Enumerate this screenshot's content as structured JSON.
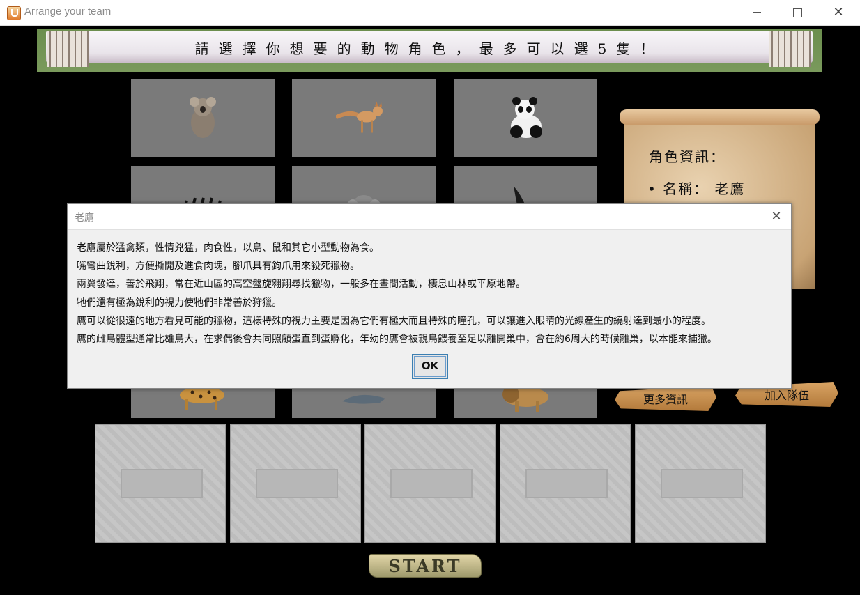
{
  "window": {
    "title": "Arrange your team",
    "minimize_icon": "minimize-icon",
    "maximize_icon": "maximize-icon",
    "close_icon": "close-icon"
  },
  "banner": {
    "text": "請選擇你想要的動物角色，最多可以選5隻！"
  },
  "animals": [
    {
      "name": "koala",
      "icon": "koala-image"
    },
    {
      "name": "fox",
      "icon": "fox-image"
    },
    {
      "name": "panda",
      "icon": "panda-image"
    },
    {
      "name": "zebra",
      "icon": "zebra-image"
    },
    {
      "name": "elephant",
      "icon": "elephant-image"
    },
    {
      "name": "eagle",
      "icon": "eagle-image"
    },
    {
      "name": "leopard",
      "icon": "leopard-image"
    },
    {
      "name": "shark",
      "icon": "shark-image"
    },
    {
      "name": "lion",
      "icon": "lion-image"
    }
  ],
  "info_scroll": {
    "title": "角色資訊：",
    "name_line": "• 名稱： 老鷹"
  },
  "buttons": {
    "more_info": "更多資訊",
    "join_team": "加入隊伍",
    "start": "START"
  },
  "team_slots": [
    "empty",
    "empty",
    "empty",
    "empty",
    "empty"
  ],
  "dialog": {
    "title": "老鷹",
    "lines": [
      "老鷹屬於猛禽類，性情兇猛，肉食性，以鳥、鼠和其它小型動物為食。",
      "嘴彎曲銳利，方便撕開及進食肉塊，腳爪具有鉤爪用來殺死獵物。",
      "兩翼發達，善於飛翔，常在近山區的高空盤旋翱翔尋找獵物，一般多在晝間活動，棲息山林或平原地帶。",
      "牠們還有極為銳利的視力使牠們非常善於狩獵。",
      "鷹可以從很遠的地方看見可能的獵物，這樣特殊的視力主要是因為它們有極大而且特殊的瞳孔，可以讓進入眼睛的光線產生的繞射達到最小的程度。",
      "鷹的雌鳥體型通常比雄鳥大，在求偶後會共同照顧蛋直到蛋孵化，年幼的鷹會被親鳥餵養至足以離開巢中，會在約6周大的時候離巢，以本能來捕獵。"
    ],
    "ok_label": "OK"
  }
}
